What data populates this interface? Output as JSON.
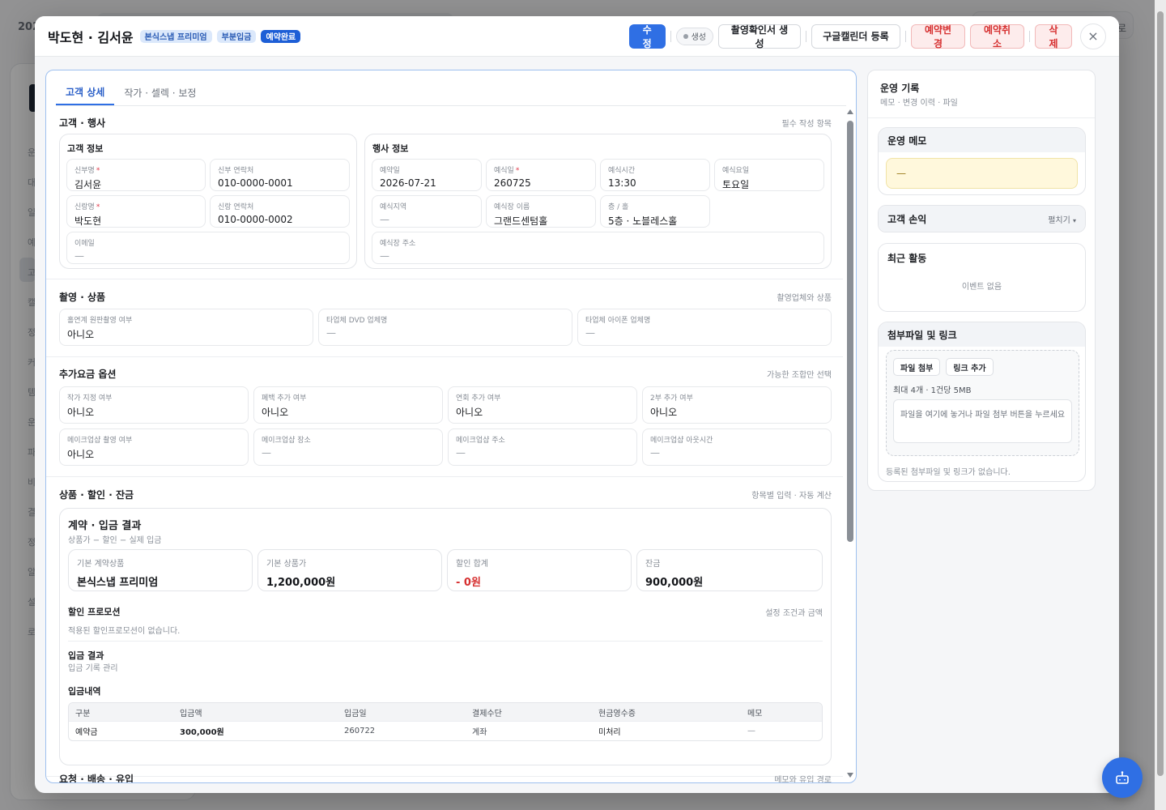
{
  "background": {
    "top_left_text": "202",
    "right_text": "로",
    "side_letters": [
      "운",
      "대",
      "일",
      "예",
      "고",
      "캘",
      "정",
      "커",
      "템",
      "운",
      "파",
      "비",
      "결",
      "정",
      "알",
      "설",
      "로"
    ]
  },
  "modal": {
    "title": "박도현 · 김서윤",
    "badges": [
      "본식스냅 프리미엄",
      "부분입금",
      "예약완료"
    ],
    "buttons": {
      "edit": "수정",
      "status_chip": "생성",
      "shoot_confirm": "촬영확인서 생성",
      "google_calendar": "구글캘린더 등록",
      "change_booking": "예약변경",
      "cancel_booking": "예약취소",
      "delete": "삭제",
      "close": "×"
    }
  },
  "tabs": [
    "고객 상세",
    "작가 · 셀렉 · 보정"
  ],
  "sections": {
    "customer_event": {
      "title": "고객 · 행사",
      "hint": "필수 작성 항목"
    },
    "shooting_products": {
      "title": "촬영 · 상품",
      "hint": "촬영업체와 상품"
    },
    "extra_options": {
      "title": "추가요금 옵션",
      "hint": "가능한 조합만 선택"
    },
    "products_discount": {
      "title": "상품 · 할인 · 잔금",
      "hint": "항목별 입력 · 자동 계산"
    },
    "request_delivery": {
      "title": "요청 · 배송 · 유입",
      "hint": "메모와 유입 경로"
    }
  },
  "customer_info": {
    "title": "고객 정보",
    "fields": [
      {
        "label": "신부명",
        "required": "*",
        "value": "김서윤"
      },
      {
        "label": "신부 연락처",
        "required": "",
        "value": "010-0000-0001"
      },
      {
        "label": "신랑명",
        "required": "*",
        "value": "박도현"
      },
      {
        "label": "신랑 연락처",
        "required": "",
        "value": "010-0000-0002"
      },
      {
        "label": "이메일",
        "required": "",
        "value": "—"
      }
    ]
  },
  "event_info": {
    "title": "행사 정보",
    "fields": [
      {
        "label": "예약일",
        "required": "",
        "value": "2026-07-21"
      },
      {
        "label": "예식일",
        "required": "*",
        "value": "260725"
      },
      {
        "label": "예식시간",
        "required": "",
        "value": "13:30"
      },
      {
        "label": "예식요일",
        "required": "",
        "value": "토요일"
      },
      {
        "label": "예식지역",
        "required": "",
        "value": "—"
      },
      {
        "label": "예식장 이름",
        "required": "",
        "value": "그랜드센텀홀"
      },
      {
        "label": "층 / 홀",
        "required": "",
        "value": "5층 · 노블레스홀"
      },
      {
        "label": "예식장 주소",
        "required": "",
        "value": "—"
      }
    ]
  },
  "shooting_fields": [
    {
      "label": "홀연계 원판촬영 여부",
      "value": "아니오"
    },
    {
      "label": "타업체 DVD 업체명",
      "value": "—"
    },
    {
      "label": "타업체 아이폰 업체명",
      "value": "—"
    }
  ],
  "option_fields": [
    {
      "label": "작가 지정 여부",
      "value": "아니오"
    },
    {
      "label": "폐백 추가 여부",
      "value": "아니오"
    },
    {
      "label": "연회 추가 여부",
      "value": "아니오"
    },
    {
      "label": "2부 추가 여부",
      "value": "아니오"
    },
    {
      "label": "메이크업샵 촬영 여부",
      "value": "아니오"
    },
    {
      "label": "메이크업샵 장소",
      "value": "—"
    },
    {
      "label": "메이크업샵 주소",
      "value": "—"
    },
    {
      "label": "메이크업샵 아웃시간",
      "value": "—"
    }
  ],
  "contract": {
    "title": "계약 · 입금 결과",
    "subtitle": "상품가 − 할인 − 실제 입금",
    "cards": [
      {
        "label": "기본 계약상품",
        "value": "본식스냅 프리미엄"
      },
      {
        "label": "기본 상품가",
        "value": "1,200,000원"
      },
      {
        "label": "할인 합계",
        "value": "- 0원"
      },
      {
        "label": "잔금",
        "value": "900,000원"
      }
    ],
    "promo_title": "할인 프로모션",
    "promo_hint": "설정 조건과 금액",
    "promo_empty": "적용된 할인프로모션이 없습니다.",
    "payment_title": "입금 결과",
    "payment_sub": "입금 기록 관리",
    "history_title": "입금내역",
    "table_headers": [
      "구분",
      "입금액",
      "입금일",
      "결제수단",
      "현금영수증",
      "메모"
    ],
    "table_rows": [
      [
        "예약금",
        "300,000원",
        "260722",
        "계좌",
        "미처리",
        "—"
      ]
    ]
  },
  "side": {
    "title": "운영 기록",
    "subtitle": "메모 · 변경 이력 · 파일",
    "memo_title": "운영 메모",
    "memo_value": "—",
    "customer_title": "고객 손익",
    "customer_expand": "펼치기",
    "activity_title": "최근 활동",
    "activity_empty": "이벤트 없음",
    "attach_title": "첨부파일 및 링크",
    "attach_file": "파일 첨부",
    "attach_link": "링크 추가",
    "attach_limit": "최대 4개 · 1건당 5MB",
    "attach_drop": "파일을 여기에 놓거나 파일 첨부 버튼을 누르세요",
    "attach_empty": "등록된 첨부파일 및 링크가 없습니다."
  },
  "colors": {
    "primary": "#2f6fe4",
    "danger": "#d63030",
    "memo_bg": "#fff8dc"
  }
}
